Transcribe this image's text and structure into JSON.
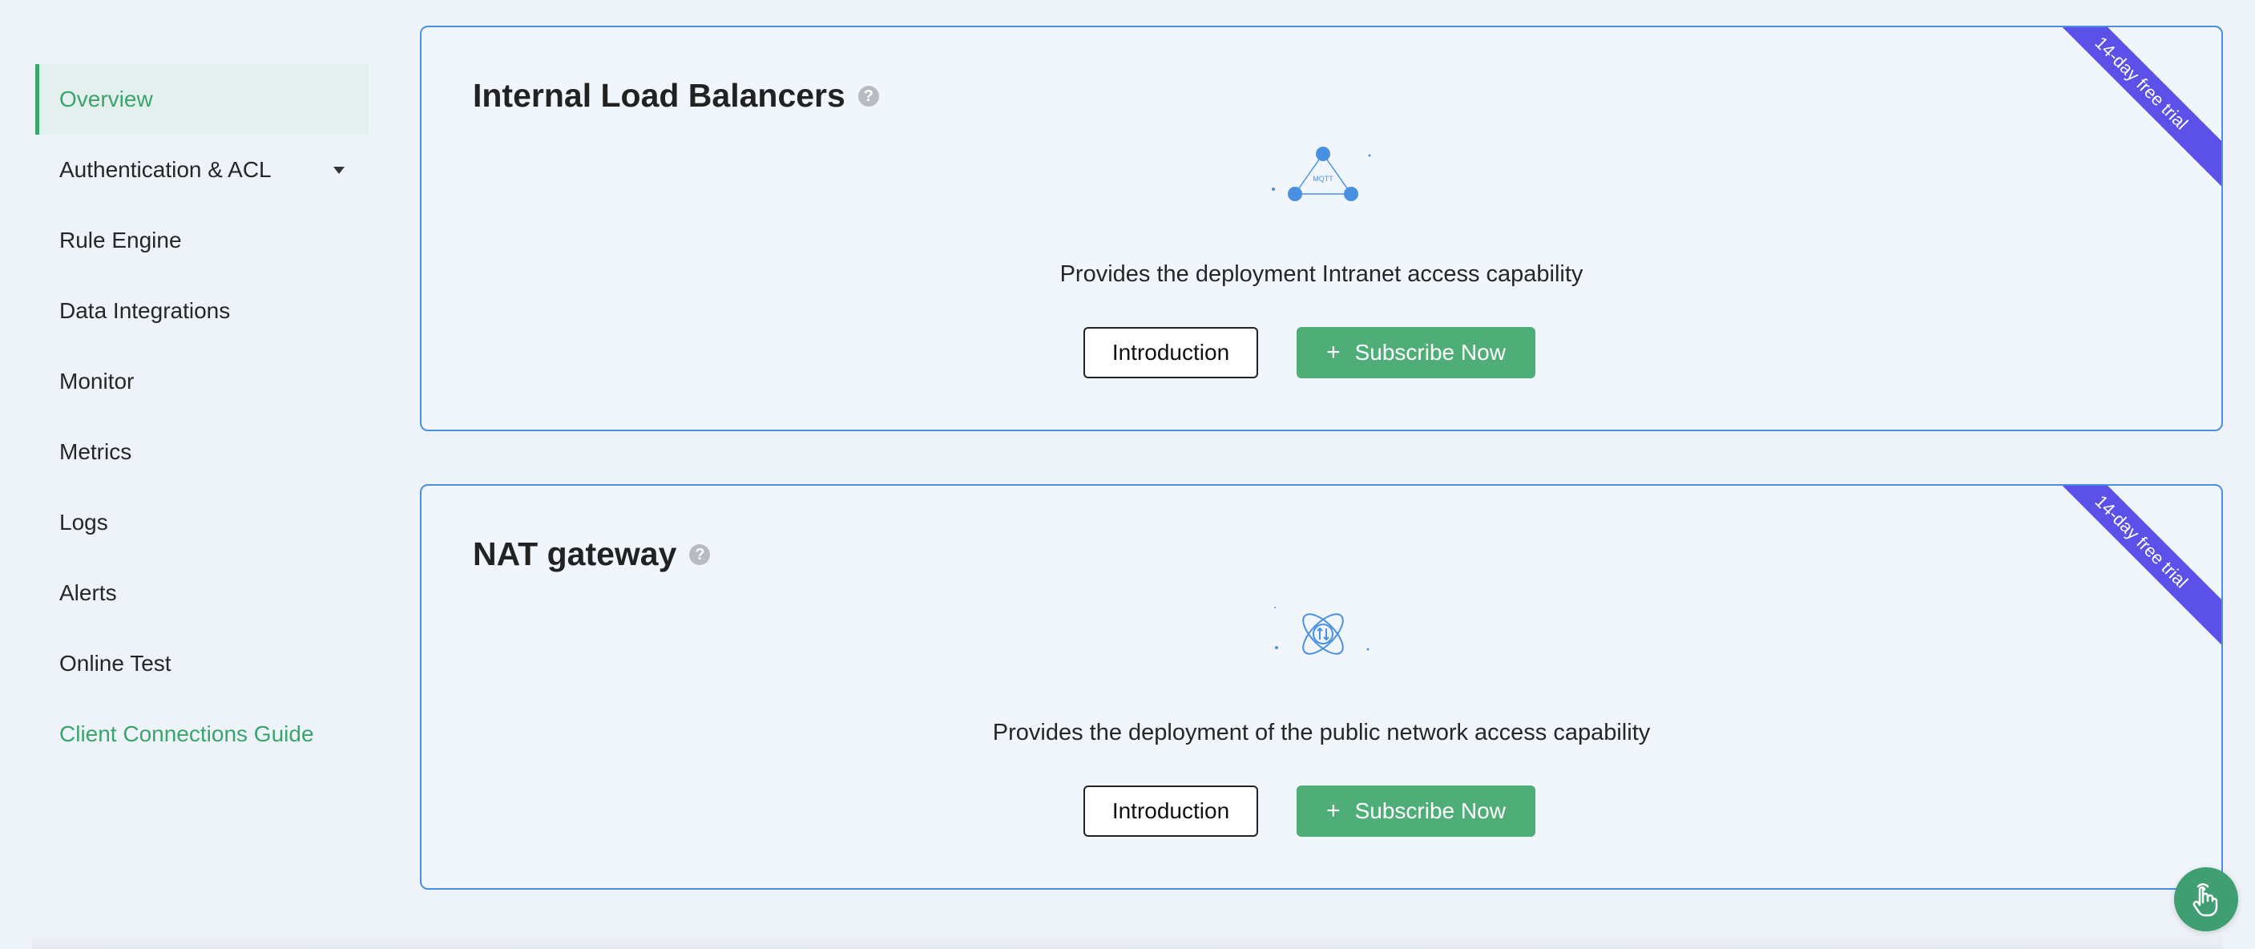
{
  "sidebar": {
    "items": [
      {
        "label": "Overview"
      },
      {
        "label": "Authentication & ACL"
      },
      {
        "label": "Rule Engine"
      },
      {
        "label": "Data Integrations"
      },
      {
        "label": "Monitor"
      },
      {
        "label": "Metrics"
      },
      {
        "label": "Logs"
      },
      {
        "label": "Alerts"
      },
      {
        "label": "Online Test"
      },
      {
        "label": "Client Connections Guide"
      }
    ]
  },
  "cards": [
    {
      "title": "Internal Load Balancers",
      "help": "?",
      "illustration_text": "MQTT",
      "description": "Provides the deployment Intranet access capability",
      "intro_label": "Introduction",
      "subscribe_plus": "+",
      "subscribe_label": "Subscribe Now",
      "ribbon": "14-day free trial"
    },
    {
      "title": "NAT gateway",
      "help": "?",
      "description": "Provides the deployment of the public network access capability",
      "intro_label": "Introduction",
      "subscribe_plus": "+",
      "subscribe_label": "Subscribe Now",
      "ribbon": "14-day free trial"
    }
  ],
  "colors": {
    "accent_green": "#3aa46d",
    "button_green": "#4fae78",
    "card_border": "#4a90e2",
    "ribbon": "#5b50e8"
  }
}
